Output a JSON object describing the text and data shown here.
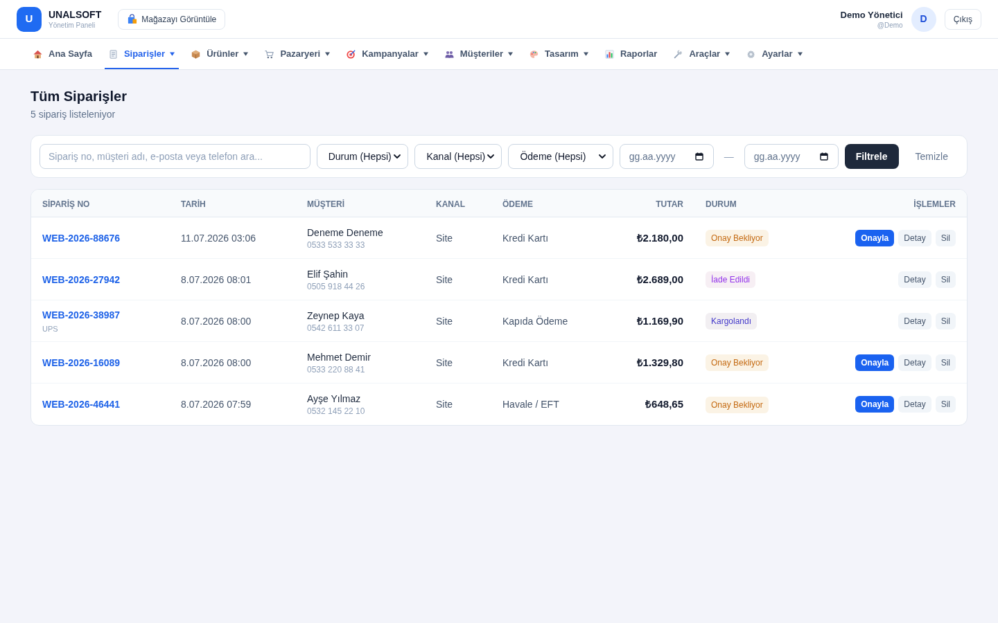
{
  "header": {
    "logo_letter": "U",
    "brand": "UNALSOFT",
    "subtitle": "Yönetim Paneli",
    "store_button": "Mağazayı Görüntüle",
    "user_name": "Demo Yönetici",
    "user_handle": "@Demo",
    "avatar_letter": "D",
    "logout_button": "Çıkış"
  },
  "nav": [
    {
      "label": "Ana Sayfa",
      "selected": false,
      "dropdown": false
    },
    {
      "label": "Siparişler",
      "selected": true,
      "dropdown": true
    },
    {
      "label": "Ürünler",
      "selected": false,
      "dropdown": true
    },
    {
      "label": "Pazaryeri",
      "selected": false,
      "dropdown": true
    },
    {
      "label": "Kampanyalar",
      "selected": false,
      "dropdown": true
    },
    {
      "label": "Müşteriler",
      "selected": false,
      "dropdown": true
    },
    {
      "label": "Tasarım",
      "selected": false,
      "dropdown": true
    },
    {
      "label": "Raporlar",
      "selected": false,
      "dropdown": false
    },
    {
      "label": "Araçlar",
      "selected": false,
      "dropdown": true
    },
    {
      "label": "Ayarlar",
      "selected": false,
      "dropdown": true
    }
  ],
  "page": {
    "title": "Tüm Siparişler",
    "subtitle": "5 sipariş listeleniyor"
  },
  "filters": {
    "search": {
      "placeholder": "Sipariş no, müşteri adı, e-posta veya telefon ara..."
    },
    "selects": [
      {
        "value": "Durum (Hepsi)"
      },
      {
        "value": "Kanal (Hepsi)"
      },
      {
        "value": "Ödeme (Hepsi)"
      }
    ],
    "date_from": {
      "placeholder": "gg.aa.yyyy"
    },
    "date_separator": "—",
    "date_to": {
      "placeholder": "gg.aa.yyyy"
    },
    "filter_button": "Filtrele",
    "clear_button": "Temizle"
  },
  "table": {
    "columns": [
      "SİPARİŞ NO",
      "TARİH",
      "MÜŞTERİ",
      "KANAL",
      "ÖDEME",
      "TUTAR",
      "DURUM",
      "İŞLEMLER"
    ],
    "rows": [
      {
        "order_no": "WEB-2026-88676",
        "date": "11.07.2026 03:06",
        "customer": {
          "name": "Deneme Deneme",
          "phone": "0533 533 33 33"
        },
        "channel": "Site",
        "payment": "Kredi Kartı",
        "total": "₺2.180,00",
        "status": {
          "label": "Onay Bekliyor",
          "color": "#c46a12"
        },
        "actions": [
          {
            "label": "Onayla",
            "kind": "approve"
          },
          {
            "label": "Detay",
            "kind": "details"
          },
          {
            "label": "Sil",
            "kind": "delete"
          }
        ]
      },
      {
        "order_no": "WEB-2026-27942",
        "date": "8.07.2026 08:01",
        "customer": {
          "name": "Elif Şahin",
          "phone": "0505 918 44 26"
        },
        "channel": "Site",
        "payment": "Kredi Kartı",
        "total": "₺2.689,00",
        "status": {
          "label": "İade Edildi",
          "color": "#9333ea"
        },
        "actions": [
          {
            "label": "Detay",
            "kind": "details"
          },
          {
            "label": "Sil",
            "kind": "delete"
          }
        ]
      },
      {
        "order_no": "WEB-2026-38987",
        "carrier": "UPS",
        "date": "8.07.2026 08:00",
        "customer": {
          "name": "Zeynep Kaya",
          "phone": "0542 611 33 07"
        },
        "channel": "Site",
        "payment": "Kapıda Ödeme",
        "total": "₺1.169,90",
        "status": {
          "label": "Kargolandı",
          "color": "#4338ca"
        },
        "actions": [
          {
            "label": "Detay",
            "kind": "details"
          },
          {
            "label": "Sil",
            "kind": "delete"
          }
        ]
      },
      {
        "order_no": "WEB-2026-16089",
        "date": "8.07.2026 08:00",
        "customer": {
          "name": "Mehmet Demir",
          "phone": "0533 220 88 41"
        },
        "channel": "Site",
        "payment": "Kredi Kartı",
        "total": "₺1.329,80",
        "status": {
          "label": "Onay Bekliyor",
          "color": "#c46a12"
        },
        "actions": [
          {
            "label": "Onayla",
            "kind": "approve"
          },
          {
            "label": "Detay",
            "kind": "details"
          },
          {
            "label": "Sil",
            "kind": "delete"
          }
        ]
      },
      {
        "order_no": "WEB-2026-46441",
        "date": "8.07.2026 07:59",
        "customer": {
          "name": "Ayşe Yılmaz",
          "phone": "0532 145 22 10"
        },
        "channel": "Site",
        "payment": "Havale / EFT",
        "total": "₺648,65",
        "status": {
          "label": "Onay Bekliyor",
          "color": "#c46a12"
        },
        "actions": [
          {
            "label": "Onayla",
            "kind": "approve"
          },
          {
            "label": "Detay",
            "kind": "details"
          },
          {
            "label": "Sil",
            "kind": "delete"
          }
        ]
      }
    ]
  }
}
